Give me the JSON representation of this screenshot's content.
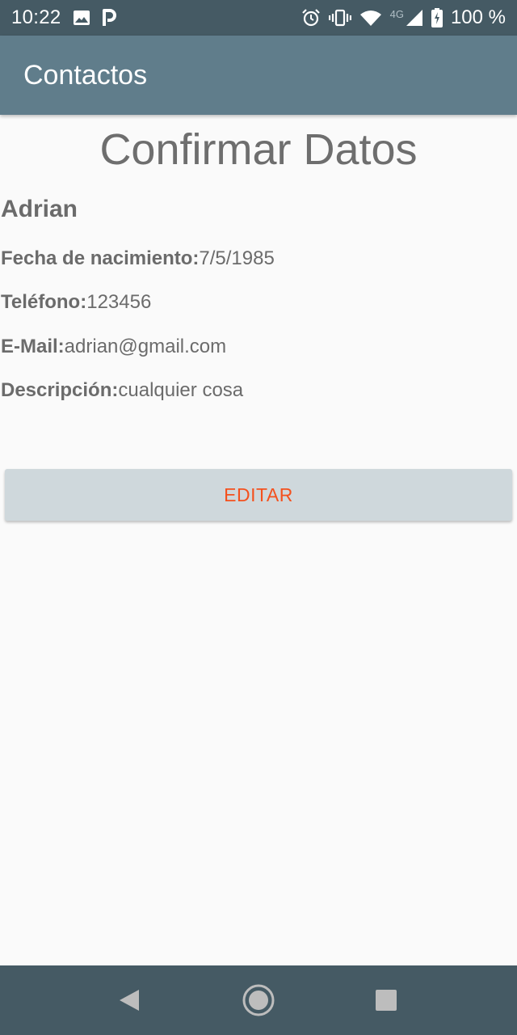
{
  "status_bar": {
    "time": "10:22",
    "battery_text": "100 %",
    "network_label": "4G",
    "icons": [
      "image-icon",
      "parking-icon",
      "alarm-icon",
      "vibrate-icon",
      "wifi-icon",
      "signal-icon",
      "battery-charging-icon"
    ]
  },
  "app_bar": {
    "title": "Contactos"
  },
  "main": {
    "title": "Confirmar Datos",
    "name": "Adrian",
    "fields": [
      {
        "label": "Fecha de nacimiento:",
        "value": "7/5/1985"
      },
      {
        "label": "Teléfono:",
        "value": "123456"
      },
      {
        "label": "E-Mail:",
        "value": "adrian@gmail.com"
      },
      {
        "label": "Descripción:",
        "value": "cualquier cosa"
      }
    ],
    "edit_button_label": "EDITAR"
  },
  "nav_bar": {
    "icons": [
      "back-icon",
      "home-icon",
      "recents-icon"
    ]
  },
  "colors": {
    "status_bar": "#455a64",
    "app_bar": "#607d8b",
    "accent": "#f4511e",
    "button_bg": "#cfd8dc",
    "text": "#6b6b6b"
  }
}
